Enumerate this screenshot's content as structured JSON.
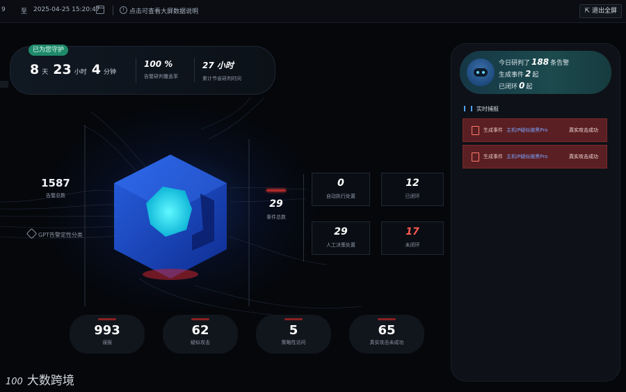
{
  "topbar": {
    "start_frag": "9",
    "to_label": "至",
    "end_datetime": "2025-04-25 15:20:47",
    "info_icon": "info-icon",
    "hint": "点击可查看大屏数据说明",
    "exit_label": "退出全屏",
    "exit_icon": "collapse-icon"
  },
  "guard": {
    "badge": "已为您守护",
    "days": "8",
    "days_unit": "天",
    "hours": "23",
    "hours_unit": "小时",
    "minutes": "4",
    "minutes_unit": "分钟",
    "coverage_value": "100 %",
    "coverage_label": "告警研判覆盖率",
    "time_value": "27 小时",
    "time_label": "累计节省研判时间"
  },
  "left": {
    "alert_total_value": "1587",
    "alert_total_label": "告警总数",
    "gpt_label": "GPT告警定性分类"
  },
  "center": {
    "event_total_value": "29",
    "event_total_label": "事件总数",
    "auto_value": "0",
    "auto_label": "自动执行处置",
    "closed_value": "12",
    "closed_label": "已闭环",
    "manual_value": "29",
    "manual_label": "人工决策处置",
    "open_value": "17",
    "open_label": "未闭环"
  },
  "bottom": [
    {
      "value": "993",
      "label": "误报"
    },
    {
      "value": "62",
      "label": "疑似攻击"
    },
    {
      "value": "5",
      "label": "策略性访问"
    },
    {
      "value": "65",
      "label": "真实攻击未成功"
    }
  ],
  "panel": {
    "line1_pre": "今日研判了",
    "line1_num": "188",
    "line1_post": "条告警",
    "line2_pre": "生成事件",
    "line2_num": "2",
    "line2_post": "起",
    "line3_pre": "已闭环",
    "line3_num": "0",
    "line3_post": "起",
    "feed_title": "实时捕报",
    "feed": [
      {
        "a": "生成事件",
        "b": "主机IP疑似被黑Pro",
        "c": "真实攻击成功"
      },
      {
        "a": "生成事件",
        "b": "主机IP疑似被黑Pro",
        "c": "真实攻击成功"
      }
    ]
  },
  "watermark": {
    "logo": "100",
    "text": "大数跨境"
  },
  "colors": {
    "accent_red": "#ff5a4f",
    "teal_badge": "#1f8a6a",
    "cube_blue": "#1a4fd8",
    "core_cyan": "#22e3e6"
  }
}
